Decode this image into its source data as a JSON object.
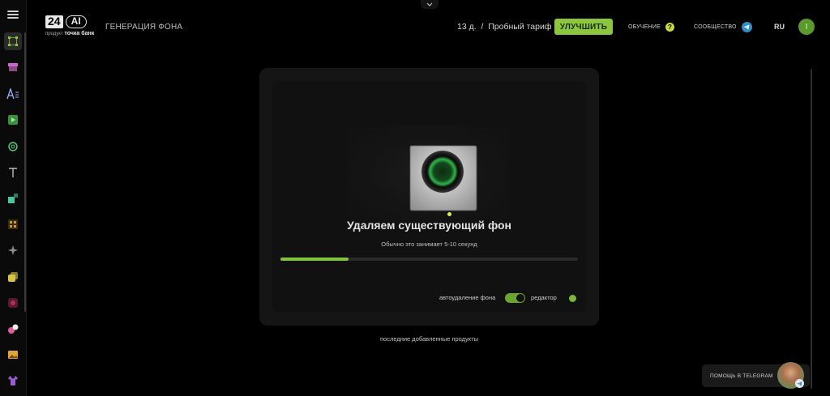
{
  "header": {
    "logo_number": "24",
    "logo_ai": "AI",
    "logo_sub_prefix": "продукт",
    "logo_sub_brand": "точка банк",
    "page_title": "ГЕНЕРАЦИЯ ФОНА",
    "trial_days": "13 д.",
    "trial_sep": "/",
    "trial_plan": "Пробный тариф",
    "upgrade_label": "УЛУЧШИТЬ",
    "learning_label": "ОБУЧЕНИЕ",
    "learning_icon": "?",
    "community_label": "СООБЩЕСТВО",
    "language": "RU",
    "avatar_letter": "I"
  },
  "processing": {
    "title": "Удаляем существующий фон",
    "hint": "Обычно это занимает 5-10 секунд",
    "progress_percent": 23
  },
  "options": {
    "auto_remove_label": "автоудаление фона",
    "auto_remove_on": true,
    "editor_label": "редактор"
  },
  "recent_label": "последние добавленные продукты",
  "telegram_help": {
    "label": "ПОМОЩЬ В TELEGRAM"
  },
  "sidebar": {
    "items": [
      {
        "name": "grid-nodes-icon",
        "color": "#8cc63f",
        "active": true
      },
      {
        "name": "store-icon",
        "color": "#d067c8"
      },
      {
        "name": "text-ai-icon",
        "color": "#9bb3ff"
      },
      {
        "name": "video-icon",
        "color": "#6bd06b"
      },
      {
        "name": "openai-icon",
        "color": "#4fcf8a"
      },
      {
        "name": "text-icon",
        "color": "#bdbdbd"
      },
      {
        "name": "shapes-icon",
        "color": "#47c7a0"
      },
      {
        "name": "grid-dots-icon",
        "color": "#c99b2e"
      },
      {
        "name": "sparkle-icon",
        "color": "#8a8a8a"
      },
      {
        "name": "layers-icon",
        "color": "#d6c44a"
      },
      {
        "name": "stamp-icon",
        "color": "#b0305a"
      },
      {
        "name": "paint-icon",
        "color": "#e05a9a"
      },
      {
        "name": "image-icon",
        "color": "#e0a53a"
      },
      {
        "name": "shirt-icon",
        "color": "#9b5ad6"
      }
    ]
  }
}
